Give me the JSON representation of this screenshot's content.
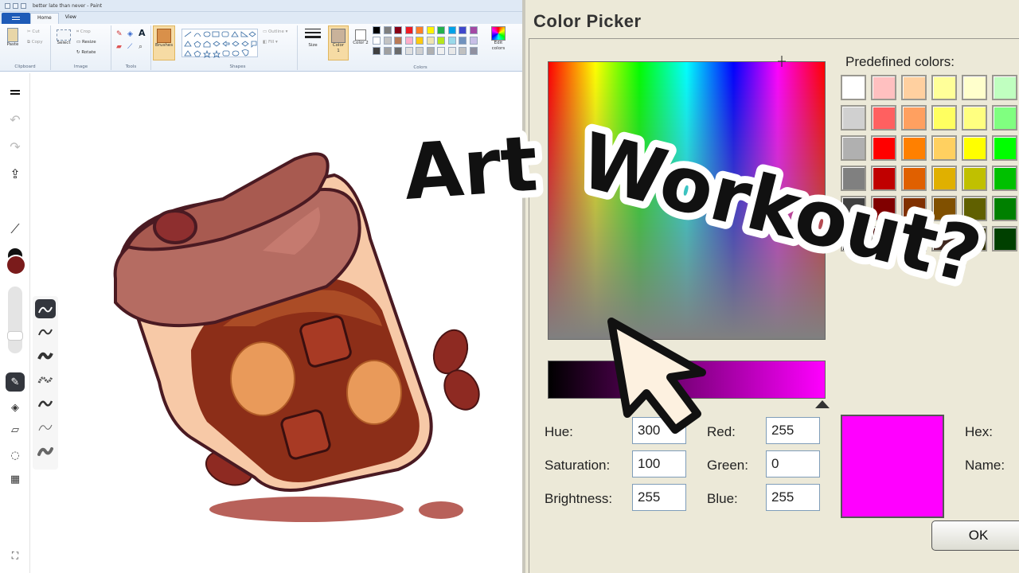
{
  "paint": {
    "window_title": "better late than never - Paint",
    "tabs": [
      "Home",
      "View"
    ],
    "clipboard": {
      "paste": "Paste",
      "cut": "Cut",
      "copy": "Copy",
      "group": "Clipboard"
    },
    "image": {
      "select": "Select",
      "crop": "Crop",
      "resize": "Resize",
      "rotate": "Rotate",
      "group": "Image"
    },
    "tools_group": "Tools",
    "brushes": "Brushes",
    "shapes": {
      "outline": "Outline",
      "fill": "Fill",
      "group": "Shapes"
    },
    "size": "Size",
    "color1": "Color 1",
    "color2": "Color 2",
    "edit_colors": "Edit colors",
    "colors_group": "Colors",
    "palette_row1": [
      "#000000",
      "#7f7f7f",
      "#880015",
      "#ed1c24",
      "#ff7f27",
      "#fff200",
      "#22b14c",
      "#00a2e8",
      "#3f48cc",
      "#a349a4"
    ],
    "palette_row2": [
      "#ffffff",
      "#c3c3c3",
      "#b97a57",
      "#ffaec9",
      "#ffc90e",
      "#efe4b0",
      "#b5e61d",
      "#99d9ea",
      "#7092be",
      "#c8bfe7"
    ],
    "palette_row3": [
      "#404040",
      "#a0a0a0",
      "#6b6b6b",
      "#e0e0e0",
      "#d0d0d0",
      "#b0b0b0",
      "#f0f0f0",
      "#e8e8e8",
      "#c0c0c0",
      "#9090a0"
    ],
    "color1_value": "#c9b29a",
    "color2_value": "#ffffff"
  },
  "side_tools": {
    "current_color": "#7a1b1b",
    "secondary_color": "#111111"
  },
  "dialog": {
    "title": "Color Picker",
    "predefined_label": "Predefined colors:",
    "predefined": [
      [
        "#ffffff",
        "#ffc0c0",
        "#ffd0a0",
        "#ffff99",
        "#ffffcc",
        "#c0ffc0"
      ],
      [
        "#d0d0d0",
        "#ff6060",
        "#ffa060",
        "#ffff60",
        "#ffff80",
        "#80ff80"
      ],
      [
        "#b0b0b0",
        "#ff0000",
        "#ff8000",
        "#ffd060",
        "#ffff00",
        "#00ff00"
      ],
      [
        "#808080",
        "#c00000",
        "#e06000",
        "#e0b000",
        "#c0c000",
        "#00c000"
      ],
      [
        "#404040",
        "#800000",
        "#803000",
        "#805000",
        "#606000",
        "#008000"
      ],
      [
        "#000000",
        "#400000",
        "#402000",
        "#402820",
        "#303000",
        "#004000"
      ]
    ],
    "fields": {
      "hue_label": "Hue:",
      "hue": "300",
      "saturation_label": "Saturation:",
      "saturation": "100",
      "brightness_label": "Brightness:",
      "brightness": "255",
      "red_label": "Red:",
      "red": "255",
      "green_label": "Green:",
      "green": "0",
      "blue_label": "Blue:",
      "blue": "255",
      "hex_label": "Hex:",
      "name_label": "Name:"
    },
    "selected_color": "#ff00ff",
    "ok": "OK"
  },
  "overlay": {
    "headline_word1": "Art",
    "headline_word2": "Workout?"
  }
}
